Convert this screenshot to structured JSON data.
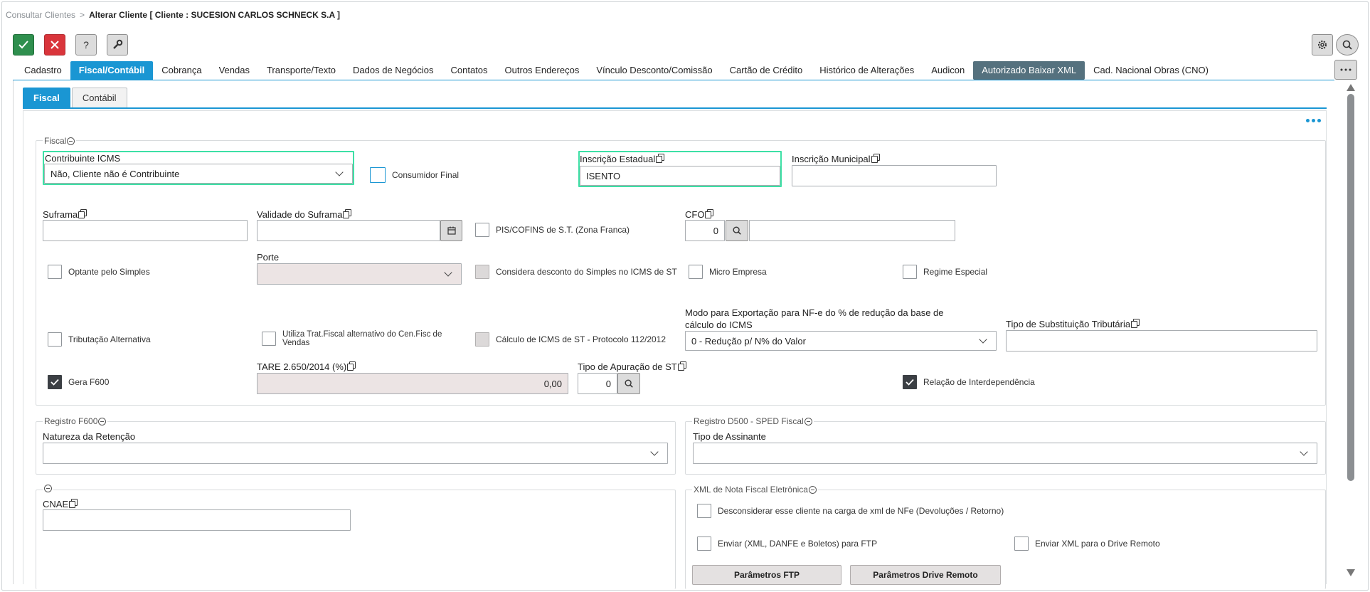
{
  "breadcrumb": {
    "parent": "Consultar Clientes",
    "separator": ">",
    "current": "Alterar Cliente",
    "client": "[ Cliente : SUCESION CARLOS SCHNECK S.A ]"
  },
  "main_tabs": [
    {
      "label": "Cadastro"
    },
    {
      "label": "Fiscal/Contábil"
    },
    {
      "label": "Cobrança"
    },
    {
      "label": "Vendas"
    },
    {
      "label": "Transporte/Texto"
    },
    {
      "label": "Dados de Negócios"
    },
    {
      "label": "Contatos"
    },
    {
      "label": "Outros Endereços"
    },
    {
      "label": "Vínculo Desconto/Comissão"
    },
    {
      "label": "Cartão de Crédito"
    },
    {
      "label": "Histórico de Alterações"
    },
    {
      "label": "Audicon"
    },
    {
      "label": "Autorizado Baixar XML"
    },
    {
      "label": "Cad. Nacional Obras (CNO)"
    }
  ],
  "sub_tabs": [
    {
      "label": "Fiscal"
    },
    {
      "label": "Contábil"
    }
  ],
  "fiscal": {
    "legend": "Fiscal",
    "contribuinte_label": "Contribuinte ICMS",
    "contribuinte_value": "Não, Cliente não é Contribuinte",
    "consumidor_final": "Consumidor Final",
    "inscricao_estadual_label": "Inscrição Estadual",
    "inscricao_estadual_value": "ISENTO",
    "inscricao_municipal_label": "Inscrição Municipal",
    "suframa_label": "Suframa",
    "validade_suframa_label": "Validade do Suframa",
    "pis_cofins": "PIS/COFINS de S.T. (Zona Franca)",
    "cfo_label": "CFO",
    "cfo_value": "0",
    "optante_simples": "Optante pelo Simples",
    "porte_label": "Porte",
    "considera_desconto": "Considera desconto do Simples no ICMS de ST",
    "micro_empresa": "Micro Empresa",
    "regime_especial": "Regime Especial",
    "modo_exportacao_label": "Modo para Exportação para NF-e do % de redução da base de cálculo do ICMS",
    "modo_exportacao_value": "0 - Redução p/ N% do Valor",
    "tipo_substituicao_label": "Tipo de Substituição Tributária",
    "tributacao_alternativa": "Tributação Alternativa",
    "utiliza_trat_fiscal": "Utiliza Trat.Fiscal alternativo do Cen.Fisc de Vendas",
    "calculo_icms_st": "Cálculo de ICMS de ST - Protocolo 112/2012",
    "gera_f600": "Gera F600",
    "tare_label": "TARE 2.650/2014 (%)",
    "tare_value": "0,00",
    "tipo_apuracao_label": "Tipo de Apuração de ST",
    "tipo_apuracao_value": "0",
    "relacao_interdependencia": "Relação de Interdependência"
  },
  "registro_f600": {
    "legend": "Registro F600",
    "natureza_label": "Natureza da Retenção"
  },
  "registro_d500": {
    "legend": "Registro D500 - SPED Fiscal",
    "tipo_assinante_label": "Tipo de Assinante"
  },
  "cnae_group": {
    "cnae_label": "CNAE"
  },
  "xml_nfe": {
    "legend": "XML de Nota Fiscal Eletrônica",
    "desconsiderar": "Desconsiderar esse cliente na carga de xml de NFe (Devoluções / Retorno)",
    "enviar_ftp": "Enviar (XML, DANFE e Boletos) para FTP",
    "enviar_drive": "Enviar XML para o Drive Remoto",
    "parametros_ftp": "Parâmetros FTP",
    "parametros_drive": "Parâmetros Drive Remoto"
  },
  "colors": {
    "accent": "#1a96d3",
    "ok": "#2f8f4e",
    "cancel": "#d9353b",
    "highlight": "#3de0a6"
  }
}
